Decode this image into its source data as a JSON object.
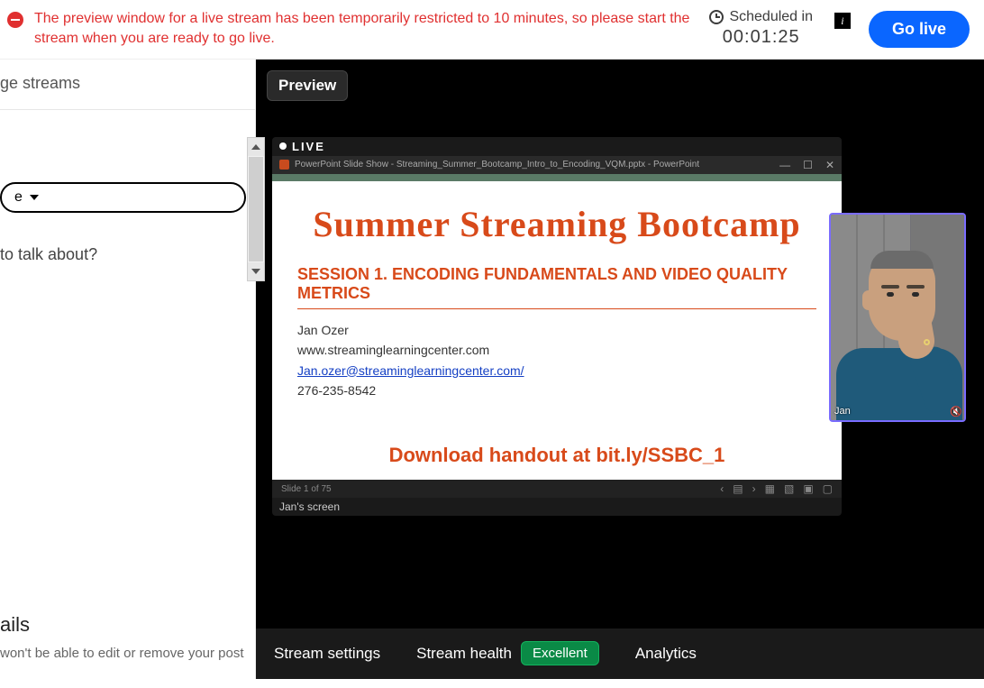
{
  "header": {
    "alert": "The preview window for a live stream has been temporarily restricted to 10 minutes, so please start the stream when you are ready to go live.",
    "scheduled_label": "Scheduled in",
    "scheduled_timer": "00:01:25",
    "go_live": "Go live"
  },
  "sidebar": {
    "streams_label": "ge streams",
    "dropdown_label": "e",
    "prompt": "to talk about?",
    "ails_label": "ails",
    "hint": "won't be able to edit or remove your post"
  },
  "stage": {
    "preview_label": "Preview",
    "live_badge": "LIVE",
    "pp_title": "PowerPoint Slide Show  -  Streaming_Summer_Bootcamp_Intro_to_Encoding_VQM.pptx - PowerPoint",
    "slide_title": "Summer Streaming Bootcamp",
    "session_hdr": "SESSION 1. ENCODING FUNDAMENTALS AND VIDEO QUALITY METRICS",
    "presenter_name": "Jan Ozer",
    "presenter_site": "www.streaminglearningcenter.com",
    "presenter_email": "Jan.ozer@streaminglearningcenter.com/",
    "presenter_phone": "276-235-8542",
    "handout": "Download handout at bit.ly/SSBC_1",
    "slide_counter": "Slide 1 of 75",
    "share_label": "Jan's screen",
    "webcam_name": "Jan"
  },
  "tabs": {
    "settings": "Stream settings",
    "health": "Stream health",
    "health_status": "Excellent",
    "analytics": "Analytics"
  }
}
